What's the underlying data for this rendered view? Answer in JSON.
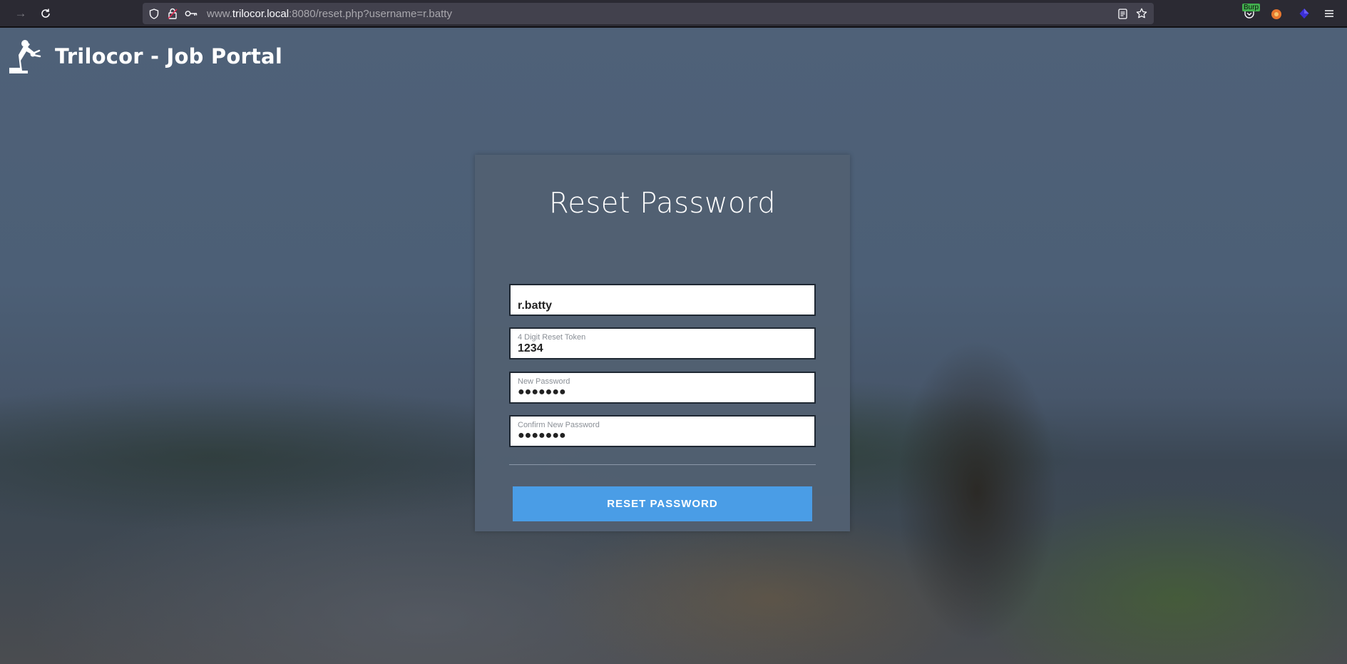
{
  "browser": {
    "url_prefix": "www.",
    "url_host": "trilocor.local",
    "url_rest": ":8080/reset.php?username=r.batty",
    "burp_badge": "Burp"
  },
  "site": {
    "title": "Trilocor - Job Portal",
    "logo_icon": "robot-arm-icon"
  },
  "form": {
    "heading": "Reset Password",
    "username_value": "r.batty",
    "token_label": "4 Digit Reset Token",
    "token_value": "1234",
    "new_password_label": "New Password",
    "new_password_value": "●●●●●●●",
    "confirm_password_label": "Confirm New Password",
    "confirm_password_value": "●●●●●●●",
    "submit_label": "RESET PASSWORD"
  },
  "colors": {
    "button": "#4a9de6",
    "card": "#526072"
  }
}
